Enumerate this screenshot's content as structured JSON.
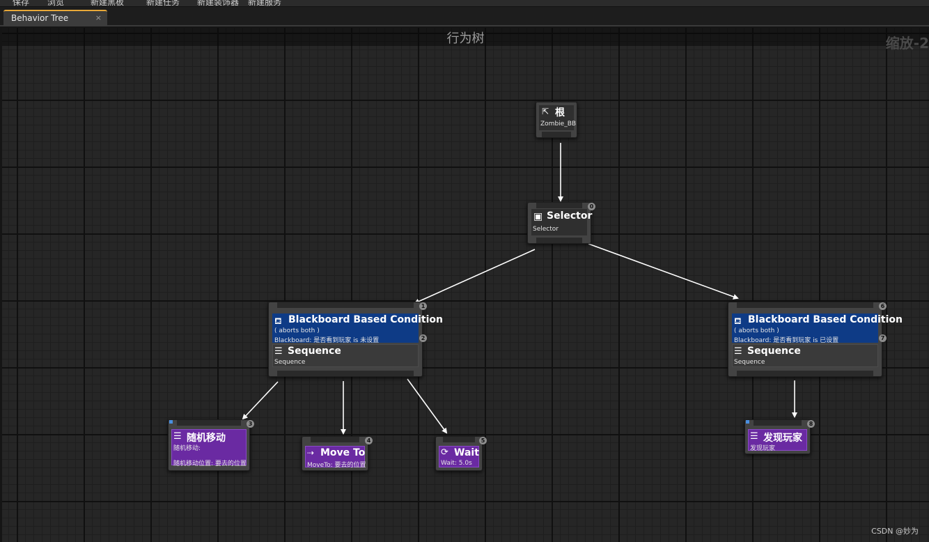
{
  "menu": {
    "items": [
      "保存",
      "浏览",
      "新建黑板",
      "新建任务",
      "新建装饰器",
      "新建服务"
    ]
  },
  "tab": {
    "label": "Behavior Tree",
    "close_glyph": "×"
  },
  "graph": {
    "title": "行为树",
    "zoom_label": "缩放-2"
  },
  "nodes": {
    "root": {
      "title": "根",
      "subtitle": "Zombie_BB",
      "icon": "root-branch-icon"
    },
    "selector": {
      "title": "Selector",
      "subtitle": "Selector",
      "index": "0",
      "icon": "selector-icon"
    },
    "left_condition": {
      "title": "Blackboard Based Condition",
      "line1": "( aborts both )",
      "line2": "Blackboard: 是否看到玩家 is 未设置",
      "index_top": "1",
      "index_side": "2",
      "icon": "blackboard-condition-icon"
    },
    "left_sequence": {
      "title": "Sequence",
      "subtitle": "Sequence",
      "icon": "sequence-icon"
    },
    "right_condition": {
      "title": "Blackboard Based Condition",
      "line1": "( aborts both )",
      "line2": "Blackboard: 是否看到玩家 is 已设置",
      "index_top": "6",
      "index_side": "7",
      "icon": "blackboard-condition-icon"
    },
    "right_sequence": {
      "title": "Sequence",
      "subtitle": "Sequence",
      "icon": "sequence-icon"
    },
    "random_move": {
      "title": "随机移动",
      "line1": "随机移动:",
      "line2": "随机移动位置: 要去的位置",
      "index": "3",
      "icon": "task-icon"
    },
    "move_to": {
      "title": "Move To",
      "subtitle": "MoveTo: 要去的位置",
      "index": "4",
      "icon": "move-to-icon"
    },
    "wait": {
      "title": "Wait",
      "subtitle": "Wait: 5.0s",
      "index": "5",
      "icon": "wait-icon"
    },
    "find_player": {
      "title": "发现玩家",
      "subtitle": "发现玩家",
      "index": "8",
      "icon": "task-icon"
    }
  },
  "watermark": "CSDN @妙为",
  "colors": {
    "condition_blue": "#0e3b86",
    "task_purple": "#6a2aa2",
    "tab_accent": "#e8a838"
  }
}
